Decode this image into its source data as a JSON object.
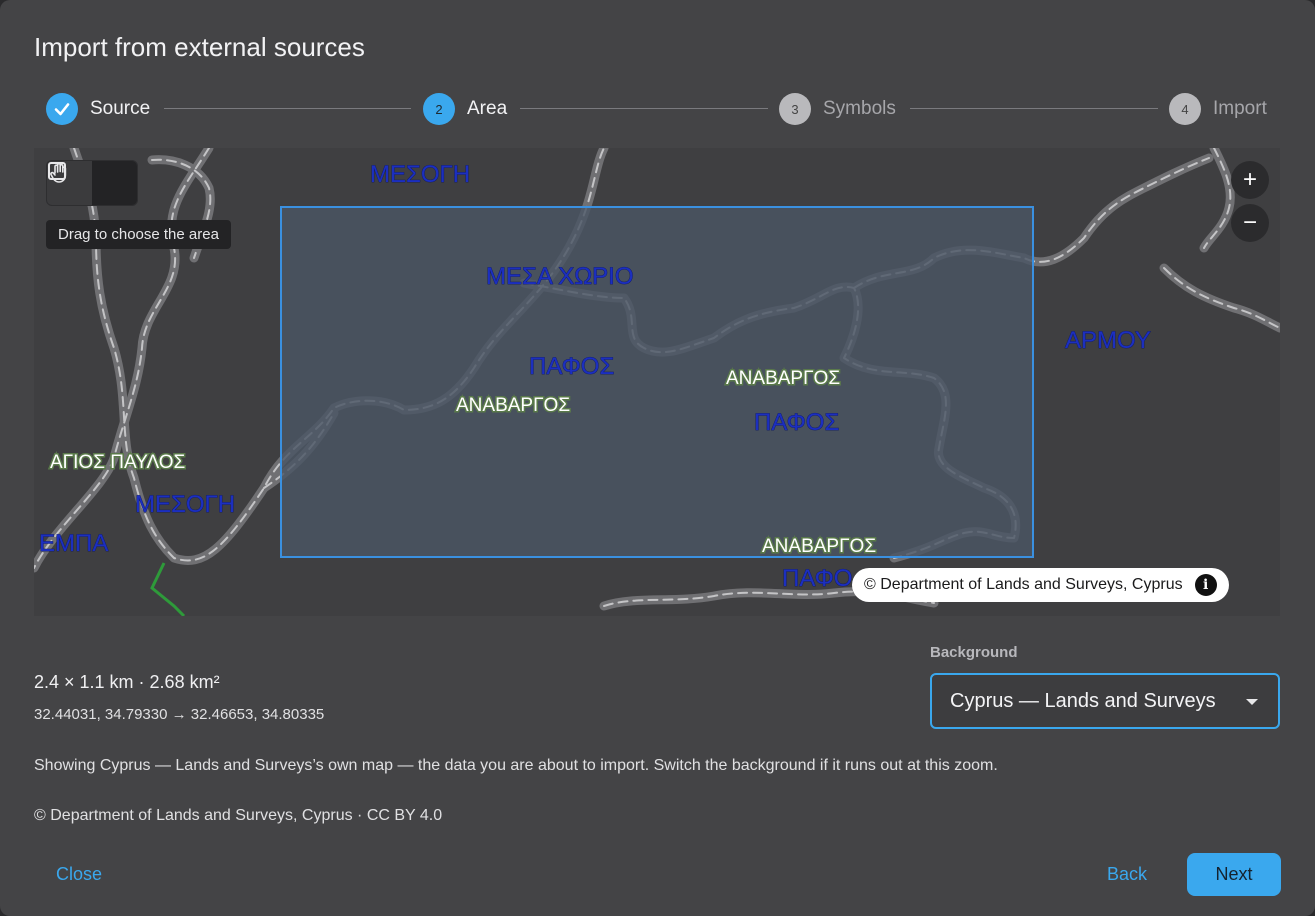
{
  "dialog": {
    "title": "Import from external sources"
  },
  "stepper": {
    "steps": [
      {
        "number": "1",
        "label": "Source",
        "state": "done"
      },
      {
        "number": "2",
        "label": "Area",
        "state": "active"
      },
      {
        "number": "3",
        "label": "Symbols",
        "state": "todo"
      },
      {
        "number": "4",
        "label": "Import",
        "state": "todo"
      }
    ]
  },
  "map": {
    "tooltip": "Drag to choose the area",
    "zoom_in": "+",
    "zoom_out": "−",
    "attribution": "© Department of Lands and Surveys, Cyprus",
    "info_glyph": "i",
    "place_labels": {
      "mesogi_top": "ΜΕΣΟΓΗ",
      "mesa_chorio": "ΜΕΣΑ ΧΩΡΙΟ",
      "pafos_center": "ΠΑΦΟΣ",
      "anavargos_left": "ΑΝΑΒΑΡΓΟΣ",
      "anavargos_right": "ΑΝΑΒΑΡΓΟΣ",
      "pafos_right": "ΠΑΦΟΣ",
      "armou": "ΑΡΜΟΥ",
      "agios_pavlos": "ΑΓΙΟΣ ΠΑΥΛΟΣ",
      "mesogi_left": "ΜΕΣΟΓΗ",
      "empa": "ΕΜΠΑ",
      "anavargos_bottom": "ΑΝΑΒΑΡΓΟΣ",
      "pafos_bottom": "ΠΑΦΟ"
    }
  },
  "area": {
    "dimensions": "2.4 × 1.1 km · 2.68 km²",
    "coordinates": "32.44031, 34.79330 → 32.46653, 34.80335"
  },
  "background": {
    "label": "Background",
    "selected": "Cyprus — Lands and Surveys"
  },
  "note": "Showing Cyprus — Lands and Surveys’s own map — the data you are about to import. Switch the background if it runs out at this zoom.",
  "credit": "© Department of Lands and Surveys, Cyprus · CC BY 4.0",
  "actions": {
    "close": "Close",
    "back": "Back",
    "next": "Next"
  },
  "colors": {
    "accent": "#3aa8ee",
    "dialog_bg": "#444446",
    "selection_fill": "#4a5564"
  }
}
